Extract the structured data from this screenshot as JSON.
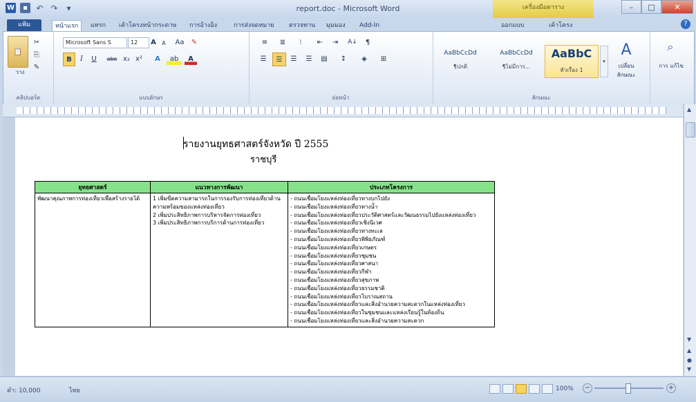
{
  "window": {
    "title": "report.doc - Microsoft Word",
    "contextual_tab": "เครื่องมือตาราง"
  },
  "qat": {
    "word_icon": "W",
    "save_icon": "save-icon",
    "undo": "↶",
    "redo": "↷",
    "custom": "▾"
  },
  "window_buttons": {
    "minimize": "–",
    "maximize": "□",
    "close": "✕"
  },
  "tabs": [
    {
      "label": "แฟ้ม"
    },
    {
      "label": "หน้าแรก"
    },
    {
      "label": "แทรก"
    },
    {
      "label": "เค้าโครงหน้ากระดาษ"
    },
    {
      "label": "การอ้างอิง"
    },
    {
      "label": "การส่งจดหมาย"
    },
    {
      "label": "ตรวจทาน"
    },
    {
      "label": "มุมมอง"
    },
    {
      "label": "Add-In"
    },
    {
      "label": "ออกแบบ"
    },
    {
      "label": "เค้าโครง"
    }
  ],
  "ribbon": {
    "clipboard": {
      "paste": "วาง",
      "label": "คลิปบอร์ด"
    },
    "font": {
      "family": "Microsoft Sans S",
      "size": "12",
      "grow": "A",
      "shrink": "A",
      "case": "Aa",
      "clear": "✎",
      "bold": "B",
      "italic": "I",
      "underline": "U",
      "strike": "abe",
      "sub": "x₂",
      "sup": "x²",
      "effects": "A",
      "highlight": "ab",
      "color": "A",
      "label": "แบบอักษร"
    },
    "paragraph": {
      "bullets": "≡",
      "numbering": "≣",
      "multilevel": "⁝",
      "decrease": "⇤",
      "increase": "⇥",
      "sort": "A↓",
      "marks": "¶",
      "label": "ย่อหน้า"
    },
    "styles": {
      "items": [
        {
          "sample": "AaBbCcDd",
          "name": "¶ปกติ"
        },
        {
          "sample": "AaBbCcDd",
          "name": "¶ไม่มีการ..."
        },
        {
          "sample": "AaBbC",
          "name": "หัวเรื่อง 1"
        }
      ],
      "change": "เปลี่ยน ลักษณะ",
      "label": "ลักษณะ"
    },
    "editing": {
      "label": "การ แก้ไข"
    }
  },
  "document": {
    "title": "รายงานยุทธศาสตร์จังหวัด ปี 2555",
    "subtitle": "ราชบุรี",
    "table": {
      "headers": [
        "ยุทธศาสตร์",
        "แนวทางการพัฒนา",
        "ประเภทโครงการ"
      ],
      "col1": "พัฒนาคุณภาพการท่องเที่ยวเพื่อสร้างรายได้",
      "col2": [
        "1 เพิ่มขีดความสามารถในการรองรับการท่องเที่ยวด้านความพร้อมของแหล่งท่องเที่ยว",
        "2 เพิ่มประสิทธิภาพการบริหารจัดการท่องเที่ยว",
        "3 เพิ่มประสิทธิภาพการบริการด้านการท่องเที่ยว"
      ],
      "col3": [
        "- ถนนเชื่อมโยงแหล่งท่องเที่ยวทางบกไปยัง",
        "- ถนนเชื่อมโยงแหล่งท่องเที่ยวทางน้ำ",
        "- ถนนเชื่อมโยงแหล่งท่องเที่ยวประวัติศาสตร์และวัฒนธรรมไปยังแหล่งท่องเที่ยว",
        "- ถนนเชื่อมโยงแหล่งท่องเที่ยวเชิงนิเวศ",
        "- ถนนเชื่อมโยงแหล่งท่องเที่ยวทางทะเล",
        "- ถนนเชื่อมโยงแหล่งท่องเที่ยวพิพิธภัณฑ์",
        "- ถนนเชื่อมโยงแหล่งท่องเที่ยวเกษตร",
        "- ถนนเชื่อมโยงแหล่งท่องเที่ยวชุมชน",
        "- ถนนเชื่อมโยงแหล่งท่องเที่ยวศาสนา",
        "- ถนนเชื่อมโยงแหล่งท่องเที่ยวกีฬา",
        "- ถนนเชื่อมโยงแหล่งท่องเที่ยวสุขภาพ",
        "- ถนนเชื่อมโยงแหล่งท่องเที่ยวธรรมชาติ",
        "- ถนนเชื่อมโยงแหล่งท่องเที่ยวโบราณสถาน",
        "- ถนนเชื่อมโยงแหล่งท่องเที่ยวและสิ่งอำนวยความสะดวกในแหล่งท่องเที่ยว",
        "- ถนนเชื่อมโยงแหล่งท่องเที่ยวในชุมชนและแหล่งเรียนรู้ในท้องถิ่น",
        "- ถนนเชื่อมโยงแหล่งท่องเที่ยวและสิ่งอำนวยความสะดวก"
      ]
    }
  },
  "status": {
    "page": "คำ: 10,000",
    "language": "ไทย",
    "zoom": "100%",
    "zoom_minus": "−",
    "zoom_plus": "+"
  },
  "colors": {
    "table_header": "#86e28a",
    "ribbon_active": "#2b5797",
    "contextual": "#e4cc45"
  }
}
